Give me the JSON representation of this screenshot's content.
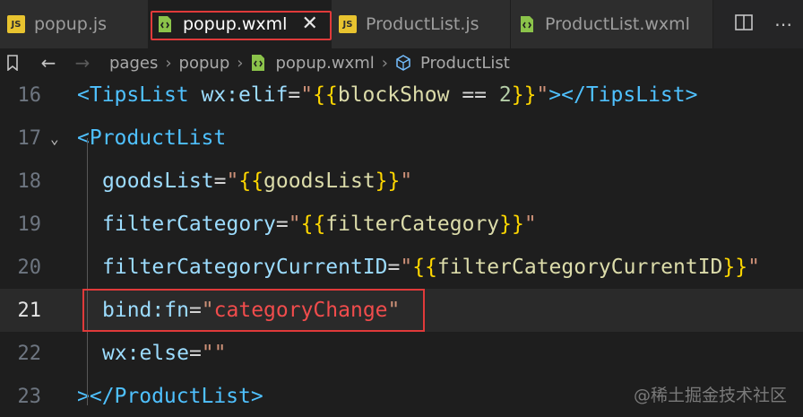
{
  "tabs": [
    {
      "label": "popup.js",
      "icon": "js-file-icon",
      "icon_text": "JS",
      "active": false
    },
    {
      "label": "popup.wxml",
      "icon": "wxml-file-icon",
      "active": true
    },
    {
      "label": "ProductList.js",
      "icon": "js-file-icon",
      "icon_text": "JS",
      "active": false
    },
    {
      "label": "ProductList.wxml",
      "icon": "wxml-file-icon",
      "active": false
    }
  ],
  "tab_close": "✕",
  "tab_actions": {
    "split": "split-editor-icon",
    "more": "⋯"
  },
  "breadcrumb": {
    "items": [
      "pages",
      "popup",
      "popup.wxml",
      "ProductList"
    ]
  },
  "code_lines": [
    {
      "num": "16"
    },
    {
      "num": "17"
    },
    {
      "num": "18"
    },
    {
      "num": "19"
    },
    {
      "num": "20"
    },
    {
      "num": "21"
    },
    {
      "num": "22"
    },
    {
      "num": "23"
    }
  ],
  "code": {
    "l16": {
      "lt": "<",
      "tag": "TipsList",
      "attr": " wx:elif",
      "eq": "=",
      "q1": "\"",
      "b1": "{{",
      "ident": "blockShow",
      "op": " == ",
      "num": "2",
      "b2": "}}",
      "q2": "\"",
      "close": "></",
      "tag2": "TipsList",
      "gt": ">"
    },
    "l17": {
      "lt": "<",
      "tag": "ProductList"
    },
    "l18": {
      "attr": "goodsList",
      "eq": "=",
      "q1": "\"",
      "b1": "{{",
      "ident": "goodsList",
      "b2": "}}",
      "q2": "\""
    },
    "l19": {
      "attr": "filterCategory",
      "eq": "=",
      "q1": "\"",
      "b1": "{{",
      "ident": "filterCategory",
      "b2": "}}",
      "q2": "\""
    },
    "l20": {
      "attr": "filterCategoryCurrentID",
      "eq": "=",
      "q1": "\"",
      "b1": "{{",
      "ident": "filterCategoryCurrentID",
      "b2": "}}",
      "q2": "\""
    },
    "l21": {
      "attr": "bind:fn",
      "eq": "=",
      "q1": "\"",
      "val": "categoryChange",
      "q2": "\""
    },
    "l22": {
      "attr": "wx:else",
      "eq": "=",
      "q": "\"\""
    },
    "l23": {
      "lt": "></",
      "tag": "ProductList",
      "gt": ">"
    }
  },
  "watermark": "@稀土掘金技术社区",
  "colors": {
    "highlight_border": "#e03a3a",
    "editor_bg": "#1e1e1e",
    "tag": "#4fc1ff",
    "attr": "#dcdcaa"
  }
}
